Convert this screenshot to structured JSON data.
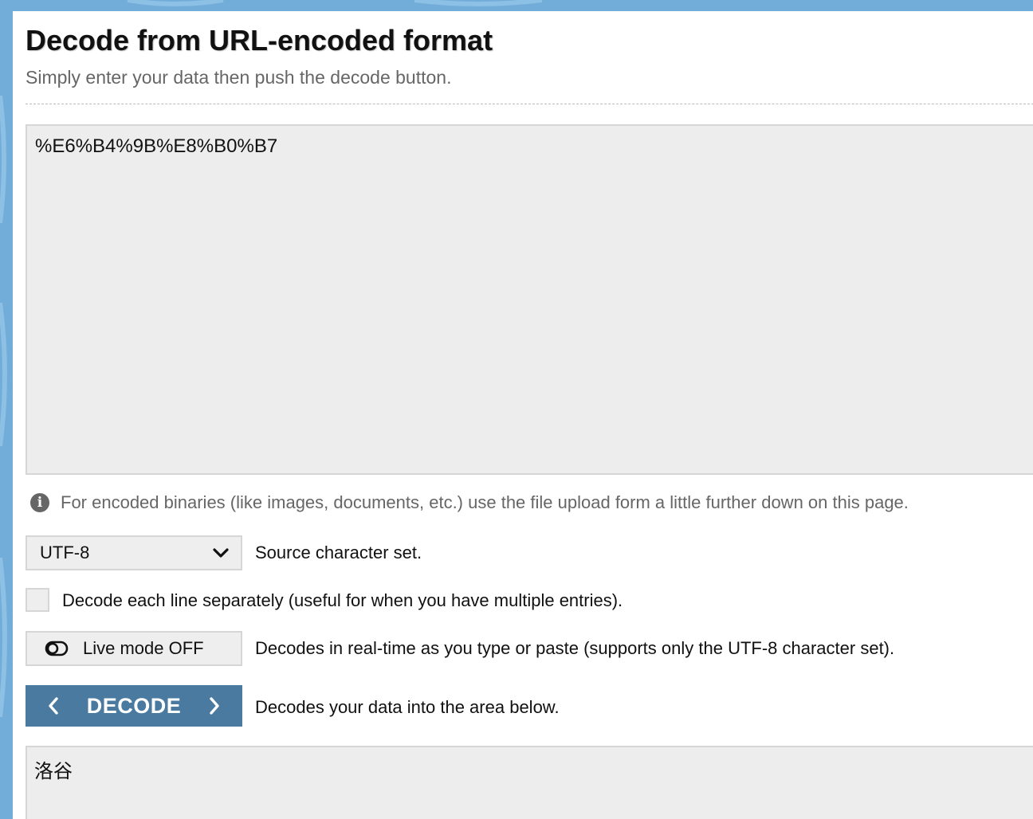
{
  "header": {
    "title": "Decode from URL-encoded format",
    "subtitle": "Simply enter your data then push the decode button."
  },
  "input": {
    "value": "%E6%B4%9B%E8%B0%B7"
  },
  "info": {
    "icon": "info-circle-icon",
    "text": "For encoded binaries (like images, documents, etc.) use the file upload form a little further down on this page."
  },
  "charset": {
    "selected": "UTF-8",
    "label": "Source character set."
  },
  "line_option": {
    "checked": false,
    "label": "Decode each line separately (useful for when you have multiple entries)."
  },
  "live_mode": {
    "button_label": "Live mode OFF",
    "description": "Decodes in real-time as you type or paste (supports only the UTF-8 character set)."
  },
  "decode": {
    "button_label": "DECODE",
    "description": "Decodes your data into the area below."
  },
  "output": {
    "value": "洛谷"
  },
  "colors": {
    "background": "#72acd8",
    "button": "#4a7aa0",
    "field": "#ededed"
  }
}
